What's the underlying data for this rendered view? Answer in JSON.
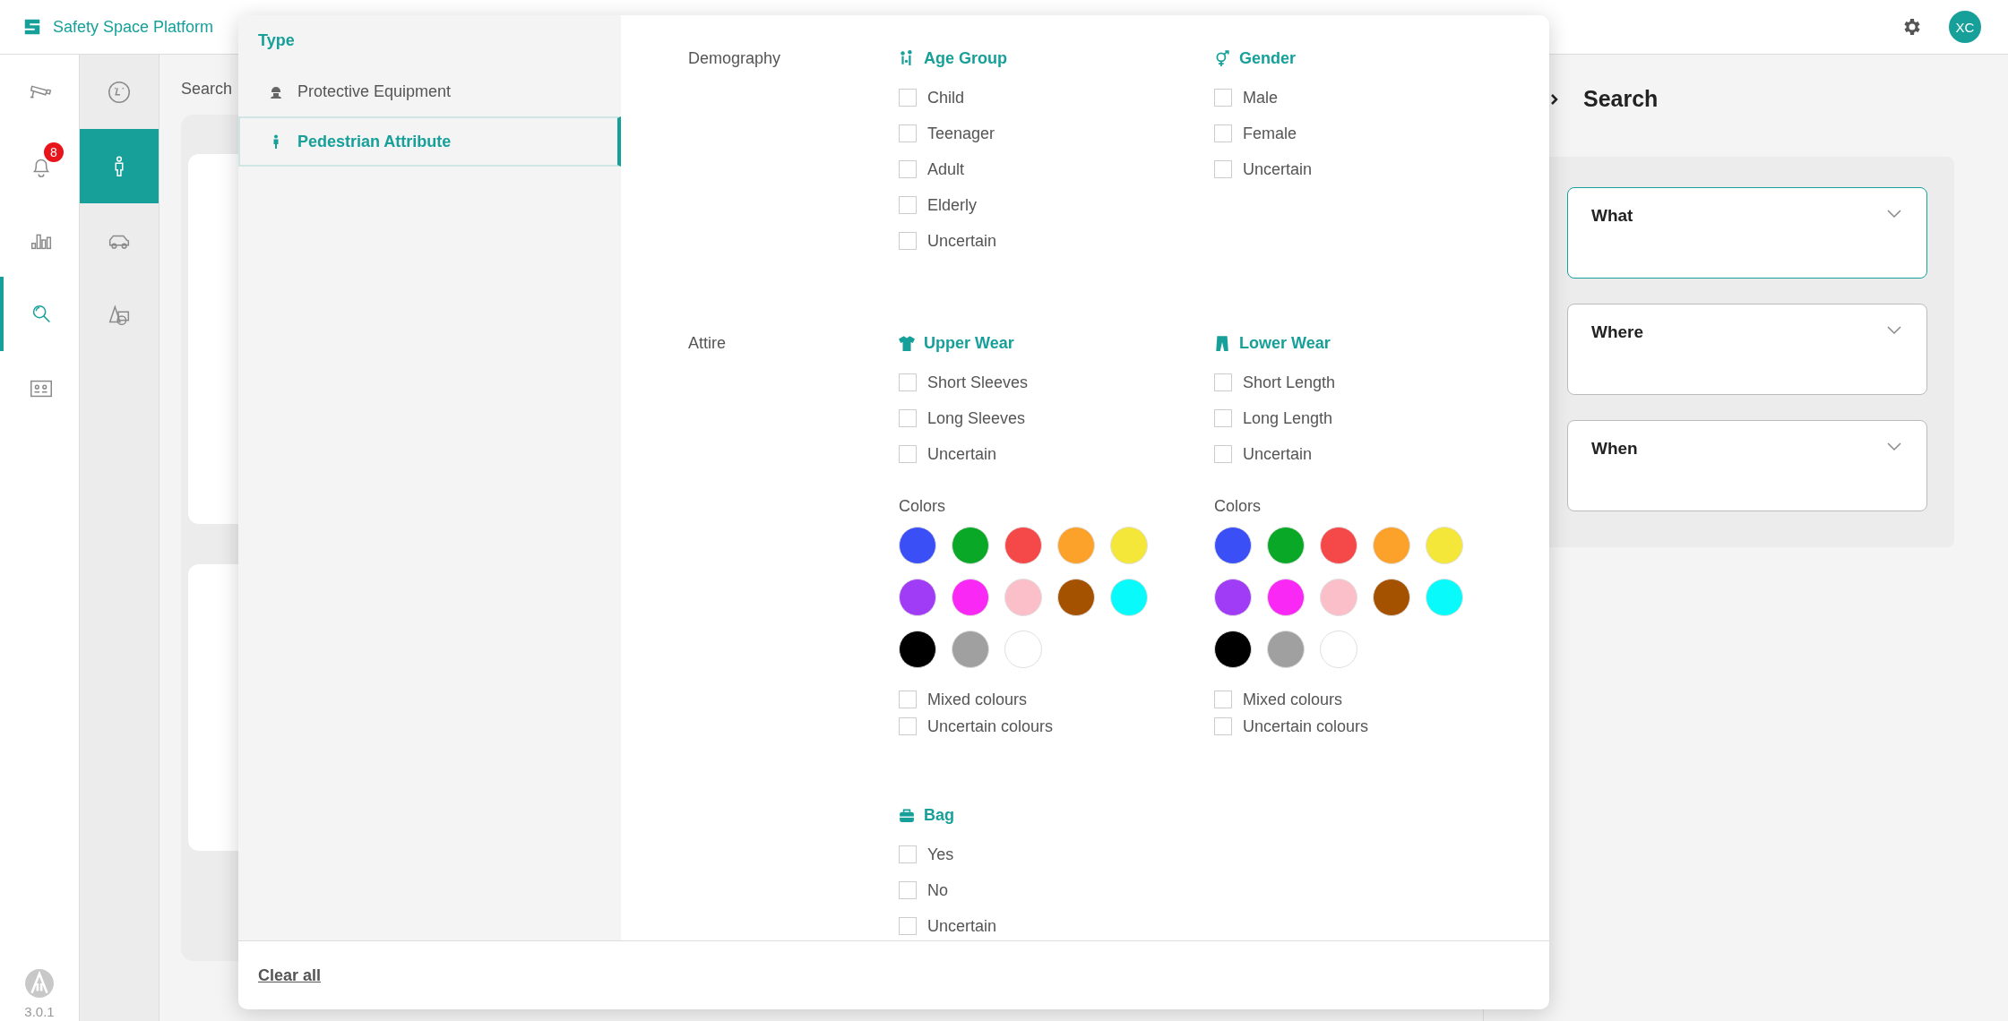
{
  "app": {
    "title": "Safety Space Platform",
    "version": "3.0.1"
  },
  "header": {
    "avatar": "XC"
  },
  "nav_rail": {
    "items": [
      {
        "kind": "camera",
        "selected": false
      },
      {
        "kind": "bell",
        "selected": false,
        "badge": "8"
      },
      {
        "kind": "chart",
        "selected": false
      },
      {
        "kind": "search",
        "selected": true
      },
      {
        "kind": "idcard",
        "selected": false
      }
    ]
  },
  "sub_rail": {
    "items": [
      {
        "kind": "face",
        "selected": false
      },
      {
        "kind": "person",
        "selected": true
      },
      {
        "kind": "car",
        "selected": false
      },
      {
        "kind": "shapes",
        "selected": false
      }
    ]
  },
  "results": {
    "title": "Search"
  },
  "filter_panel": {
    "type_heading": "Type",
    "types": [
      {
        "label": "Protective Equipment",
        "kind": "helmet",
        "selected": false
      },
      {
        "label": "Pedestrian Attribute",
        "kind": "person",
        "selected": true
      }
    ],
    "sections": [
      {
        "label": "Demography",
        "groups": [
          {
            "title": "Age Group",
            "kind": "people",
            "options": [
              {
                "label": "Child",
                "checked": false
              },
              {
                "label": "Teenager",
                "checked": false
              },
              {
                "label": "Adult",
                "checked": false
              },
              {
                "label": "Elderly",
                "checked": false
              },
              {
                "label": "Uncertain",
                "checked": false
              }
            ]
          },
          {
            "title": "Gender",
            "kind": "gender",
            "options": [
              {
                "label": "Male",
                "checked": false
              },
              {
                "label": "Female",
                "checked": false
              },
              {
                "label": "Uncertain",
                "checked": false
              }
            ]
          }
        ]
      },
      {
        "label": "Attire",
        "groups": [
          {
            "title": "Upper Wear",
            "kind": "shirt",
            "options": [
              {
                "label": "Short Sleeves",
                "checked": false
              },
              {
                "label": "Long Sleeves",
                "checked": false
              },
              {
                "label": "Uncertain",
                "checked": false
              }
            ],
            "colors": {
              "label": "Colors",
              "swatches": [
                {
                  "color": "#3a4ff5"
                },
                {
                  "color": "#0aa827"
                },
                {
                  "color": "#f54848"
                },
                {
                  "color": "#fca12a"
                },
                {
                  "color": "#f5e63a"
                },
                {
                  "color": "#a03cf5"
                },
                {
                  "color": "#fa28f5"
                },
                {
                  "color": "#fbbfc9"
                },
                {
                  "color": "#a45200"
                },
                {
                  "color": "#08fafa"
                },
                {
                  "color": "#000000"
                },
                {
                  "color": "#a0a0a0"
                },
                {
                  "color": "#ffffff"
                }
              ],
              "options": [
                {
                  "label": "Mixed colours",
                  "checked": false
                },
                {
                  "label": "Uncertain colours",
                  "checked": false
                }
              ]
            }
          },
          {
            "title": "Lower Wear",
            "kind": "pants",
            "options": [
              {
                "label": "Short Length",
                "checked": false
              },
              {
                "label": "Long Length",
                "checked": false
              },
              {
                "label": "Uncertain",
                "checked": false
              }
            ],
            "colors": {
              "label": "Colors",
              "swatches": [
                {
                  "color": "#3a4ff5"
                },
                {
                  "color": "#0aa827"
                },
                {
                  "color": "#f54848"
                },
                {
                  "color": "#fca12a"
                },
                {
                  "color": "#f5e63a"
                },
                {
                  "color": "#a03cf5"
                },
                {
                  "color": "#fa28f5"
                },
                {
                  "color": "#fbbfc9"
                },
                {
                  "color": "#a45200"
                },
                {
                  "color": "#08fafa"
                },
                {
                  "color": "#000000"
                },
                {
                  "color": "#a0a0a0"
                },
                {
                  "color": "#ffffff"
                }
              ],
              "options": [
                {
                  "label": "Mixed colours",
                  "checked": false
                },
                {
                  "label": "Uncertain colours",
                  "checked": false
                }
              ]
            }
          },
          {
            "title": "Bag",
            "kind": "bag",
            "options": [
              {
                "label": "Yes",
                "checked": false
              },
              {
                "label": "No",
                "checked": false
              },
              {
                "label": "Uncertain",
                "checked": false
              }
            ]
          }
        ]
      }
    ],
    "clear_all": "Clear all"
  },
  "search_panel": {
    "title": "Search",
    "fields": [
      {
        "label": "What",
        "focused": true
      },
      {
        "label": "Where",
        "focused": false
      },
      {
        "label": "When",
        "focused": false
      }
    ]
  }
}
